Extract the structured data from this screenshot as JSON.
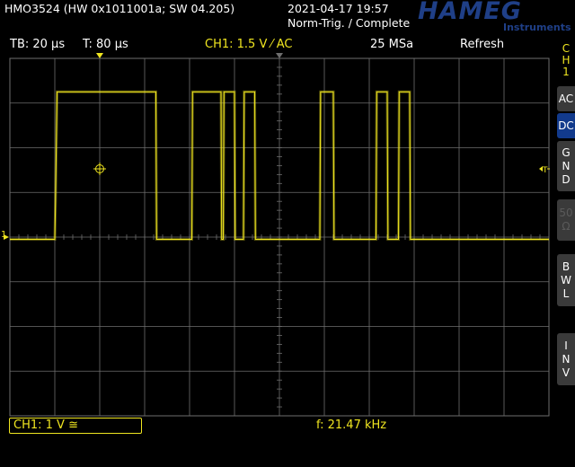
{
  "header": {
    "model": "HMO3524 (HW 0x1011001a; SW 04.205)",
    "datetime": "2021-04-17 19:57",
    "trigger_status": "Norm-Trig. / Complete",
    "logo": "HAMEG",
    "logo_sub": "Instruments"
  },
  "infobar": {
    "timebase": "TB: 20 µs",
    "trigger_time": "T: 80 µs",
    "channel": "CH1: 1.5 V ⁄ AC",
    "sample_rate": "25 MSa",
    "mode": "Refresh"
  },
  "side_menu": {
    "channel": [
      "C",
      "H",
      "1"
    ],
    "ac": "AC",
    "dc": "DC",
    "gnd": [
      "G",
      "N",
      "D"
    ],
    "fifty_ohm": [
      "50",
      "Ω"
    ],
    "bwl": [
      "B",
      "W",
      "L"
    ],
    "inv": [
      "I",
      "N",
      "V"
    ]
  },
  "bottom": {
    "channel_scale": "CH1: 1 V ≅",
    "frequency": "f: 21.47 kHz"
  },
  "markers": {
    "ch1_ground": "1",
    "trigger_level": "T"
  },
  "colors": {
    "trace": "#f0e620",
    "grid": "#6e6e6e",
    "active_button": "#123a8c",
    "logo": "#1f3f87"
  },
  "chart_data": {
    "type": "line",
    "title": "",
    "xlabel": "",
    "ylabel": "",
    "grid": true,
    "x_divisions": 12,
    "y_divisions": 8,
    "timebase_us_per_div": 20,
    "volts_per_div": 1,
    "xlim_us": [
      -20,
      220
    ],
    "ylim_div": [
      -4,
      4
    ],
    "series": [
      {
        "name": "CH1",
        "x_us": [
          -20,
          0,
          0.3,
          1,
          45,
          45.3,
          61,
          61.3,
          74,
          74.3,
          75,
          75.3,
          80,
          80.3,
          84,
          84.3,
          89,
          89.3,
          118,
          118.3,
          124,
          124.3,
          143,
          143.3,
          148,
          148.3,
          153,
          153.3,
          158,
          158.3,
          220
        ],
        "y_div": [
          -0.05,
          -0.05,
          0.8,
          3.25,
          3.25,
          -0.05,
          -0.05,
          3.25,
          3.25,
          -0.05,
          -0.05,
          3.25,
          3.25,
          -0.05,
          -0.05,
          3.25,
          3.25,
          -0.05,
          -0.05,
          3.25,
          3.25,
          -0.05,
          -0.05,
          3.25,
          3.25,
          -0.05,
          -0.05,
          3.25,
          3.25,
          -0.05,
          -0.05
        ]
      }
    ]
  }
}
